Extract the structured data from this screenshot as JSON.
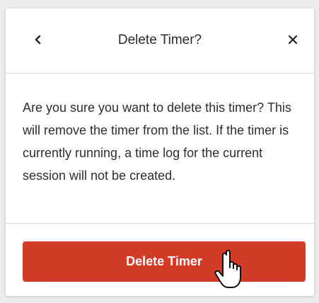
{
  "dialog": {
    "title": "Delete Timer?",
    "back_icon": "chevron-left-icon",
    "close_icon": "close-icon",
    "message": "Are you sure you want to delete this timer? This will remove the timer from the list. If the timer is currently running, a time log for the current session will not be created.",
    "confirm_label": "Delete Timer"
  },
  "colors": {
    "danger": "#d23b27",
    "text": "#2e2e2e",
    "divider": "#dcdcdc"
  },
  "cursor_icon": "hand-pointer-icon"
}
